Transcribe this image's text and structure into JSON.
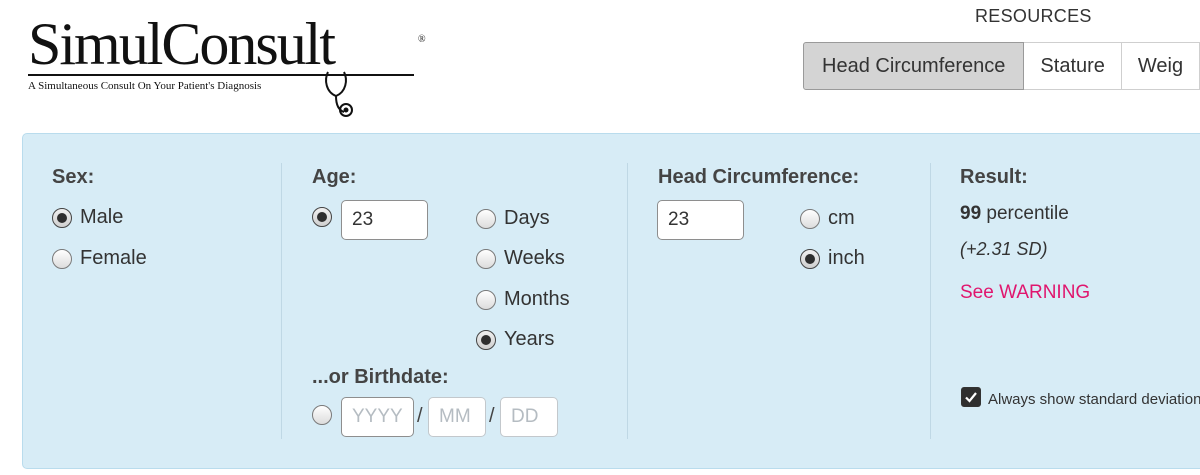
{
  "brand": {
    "name": "SimulConsult",
    "registered_mark": "®",
    "tagline": "A Simultaneous Consult On Your Patient's Diagnosis"
  },
  "resources": {
    "label": "RESOURCES",
    "tabs": [
      {
        "label": "Head Circumference",
        "active": true
      },
      {
        "label": "Stature",
        "active": false
      },
      {
        "label": "Weig",
        "active": false
      }
    ]
  },
  "form": {
    "sex": {
      "label": "Sex:",
      "options": [
        {
          "label": "Male",
          "checked": true
        },
        {
          "label": "Female",
          "checked": false
        }
      ]
    },
    "age": {
      "label": "Age:",
      "value": "23",
      "radio_checked": true,
      "units": [
        {
          "label": "Days",
          "checked": false
        },
        {
          "label": "Weeks",
          "checked": false
        },
        {
          "label": "Months",
          "checked": false
        },
        {
          "label": "Years",
          "checked": true
        }
      ],
      "birthdate": {
        "label": "...or Birthdate:",
        "radio_checked": false,
        "year_placeholder": "YYYY",
        "month_placeholder": "MM",
        "day_placeholder": "DD",
        "separator": "/"
      }
    },
    "head_circumference": {
      "label": "Head Circumference:",
      "value": "23",
      "units": [
        {
          "label": "cm",
          "checked": false
        },
        {
          "label": "inch",
          "checked": true
        }
      ]
    },
    "result": {
      "label": "Result:",
      "percentile_value": "99",
      "percentile_text": "percentile",
      "sd": "(+2.31 SD)",
      "warning": "See WARNING",
      "warning_color": "#e0166e",
      "always_show_sd": {
        "label": "Always show standard deviation",
        "checked": true
      }
    }
  },
  "colors": {
    "panel_background": "#d7ecf6",
    "active_tab": "#d4d4d4"
  }
}
